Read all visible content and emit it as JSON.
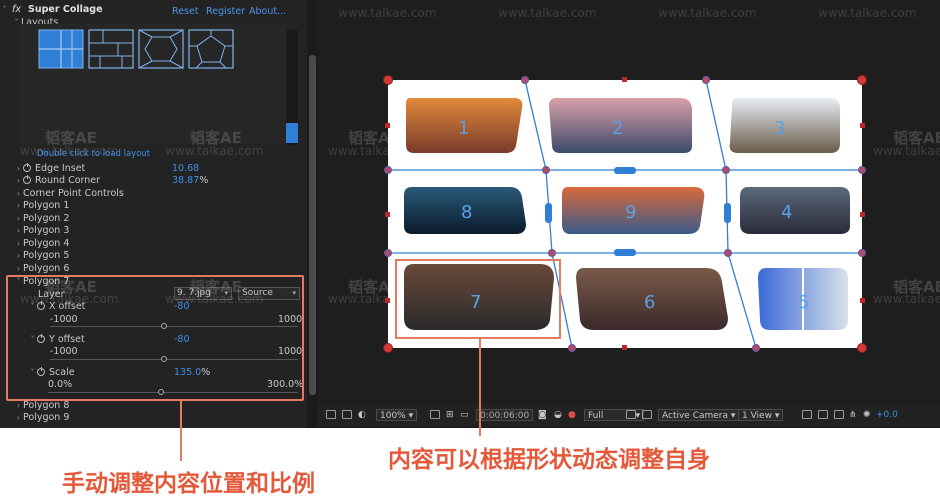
{
  "panel": {
    "fx_label": "fx",
    "effect_name": "Super Collage",
    "links": {
      "reset": "Reset",
      "register": "Register",
      "about": "About..."
    },
    "layouts_label": "Layouts",
    "layouts_hint": "Double click to load layout",
    "properties": [
      {
        "name": "Edge Inset",
        "value": "10.68",
        "unit": ""
      },
      {
        "name": "Round Corner",
        "value": "38.87",
        "unit": "%"
      }
    ],
    "groups": [
      "Corner Point Controls",
      "Polygon 1",
      "Polygon 2",
      "Polygon 3",
      "Polygon 4",
      "Polygon 5",
      "Polygon 6"
    ],
    "polygon7": {
      "name": "Polygon 7",
      "layer_label": "Layer",
      "layer_value": "9. 7.jpg",
      "source_value": "Source",
      "x_offset": {
        "name": "X offset",
        "value": "-80",
        "min": "-1000",
        "max": "1000",
        "level": -0.08
      },
      "y_offset": {
        "name": "Y offset",
        "value": "-80",
        "min": "-1000",
        "max": "1000",
        "level": -0.08
      },
      "scale": {
        "name": "Scale",
        "value": "135.0",
        "unit": "%",
        "min": "0.0%",
        "max": "300.0%",
        "level": 0.45
      }
    },
    "groups_after": [
      "Polygon 8",
      "Polygon 9"
    ]
  },
  "viewer": {
    "cells": [
      {
        "number": "1",
        "colors": [
          "#e08a3a",
          "#7a3a2a"
        ]
      },
      {
        "number": "2",
        "colors": [
          "#d9a0a8",
          "#3a4a6a"
        ]
      },
      {
        "number": "3",
        "colors": [
          "#e8eef5",
          "#6a5a4a"
        ]
      },
      {
        "number": "8",
        "colors": [
          "#2a5a7a",
          "#0a1a2a"
        ]
      },
      {
        "number": "9",
        "colors": [
          "#d96a3a",
          "#3a5a8a"
        ]
      },
      {
        "number": "4",
        "colors": [
          "#5a6a7a",
          "#2a2a3a"
        ]
      },
      {
        "number": "7",
        "colors": [
          "#6a4a3a",
          "#2a2a2a"
        ]
      },
      {
        "number": "6",
        "colors": [
          "#7a5a4a",
          "#3a2a2a"
        ]
      },
      {
        "number": "5",
        "colors": [
          "#3a6ad9",
          "#d9e0ea"
        ]
      }
    ],
    "toolbar": {
      "zoom": "100%",
      "timecode": "0:00:06:00",
      "resolution": "Full",
      "camera": "Active Camera",
      "views": "1 View",
      "exposure": "+0.0"
    },
    "watermark_text": "www.talkae.com",
    "watermark_brand": "韬客AE"
  },
  "captions": {
    "left": "手动调整内容位置和比例",
    "right": "内容可以根据形状动态调整自身"
  },
  "colors": {
    "accent_blue": "#3d8ee8",
    "highlight": "#e47a5f",
    "caption": "#e5593a"
  }
}
